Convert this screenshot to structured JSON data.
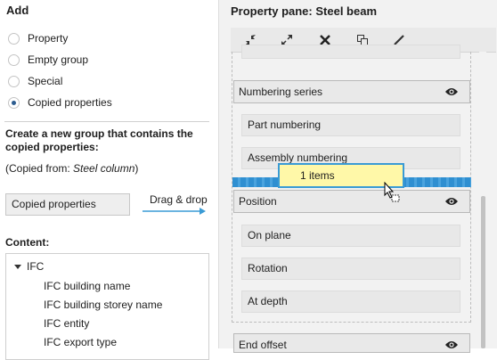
{
  "add_panel": {
    "heading": "Add",
    "options": [
      {
        "label": "Property",
        "selected": false
      },
      {
        "label": "Empty group",
        "selected": false
      },
      {
        "label": "Special",
        "selected": false
      },
      {
        "label": "Copied properties",
        "selected": true
      }
    ],
    "description": "Create a new group that contains the copied properties:",
    "copied_from_prefix": "(Copied from: ",
    "copied_from_name": "Steel column",
    "copied_from_suffix": ")",
    "copied_box_label": "Copied properties",
    "drag_drop_label": "Drag & drop",
    "content_heading": "Content:",
    "tree": {
      "root": "IFC",
      "children": [
        "IFC building name",
        "IFC building storey name",
        "IFC entity",
        "IFC export type"
      ]
    }
  },
  "property_pane": {
    "title": "Property pane: Steel beam",
    "toolbar": {
      "icons": [
        "collapse-icon",
        "expand-icon",
        "delete-icon",
        "copy-icon",
        "edit-icon"
      ]
    },
    "groups": [
      {
        "name": "Numbering series",
        "fields": [
          "Part numbering",
          "Assembly numbering"
        ]
      },
      {
        "name": "Position",
        "fields": [
          "On plane",
          "Rotation",
          "At depth"
        ]
      },
      {
        "name": "End offset",
        "fields": []
      }
    ],
    "drag_item_label": "1 items"
  },
  "colors": {
    "accent": "#3a9bd5",
    "drag_highlight": "#fff8a8",
    "drop_indicator": "#2f8fd1",
    "radio_selected": "#2c5c8f"
  }
}
